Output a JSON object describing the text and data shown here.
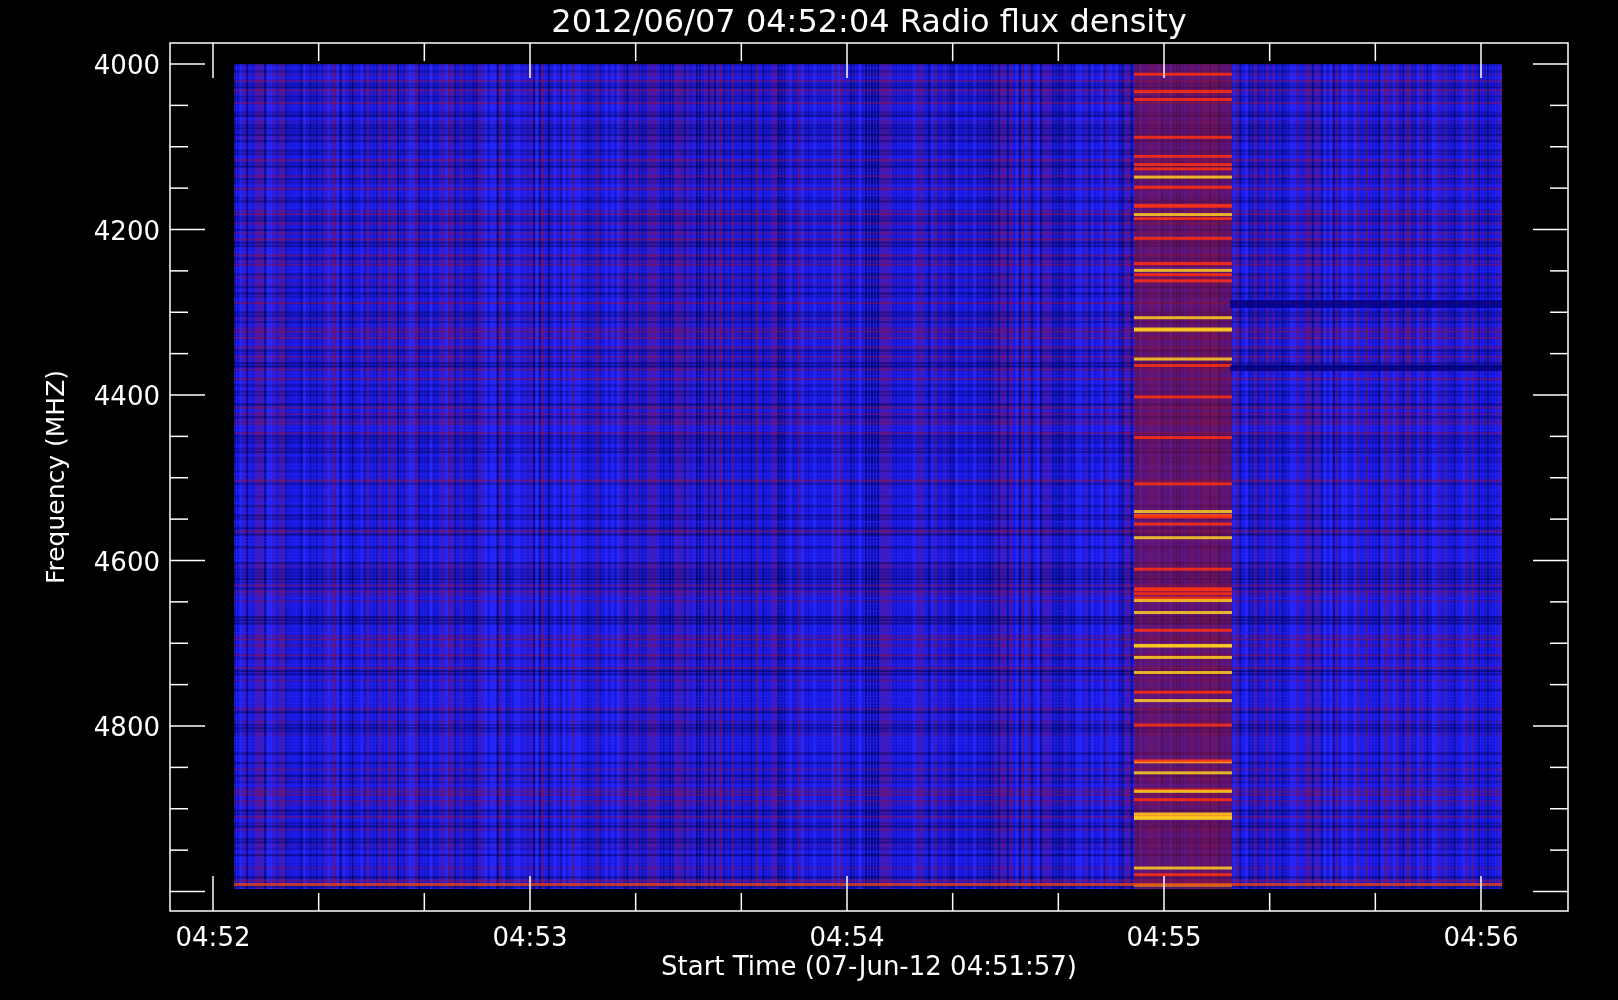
{
  "title": "2012/06/07 04:52:04 Radio flux density",
  "y_axis": {
    "label": "Frequency (MHZ)",
    "ticks": [
      "4000",
      "4200",
      "4400",
      "4600",
      "4800"
    ]
  },
  "x_axis": {
    "label": "Start Time (07-Jun-12 04:51:57)",
    "ticks": [
      "04:52",
      "04:53",
      "04:54",
      "04:55",
      "04:56"
    ]
  }
}
